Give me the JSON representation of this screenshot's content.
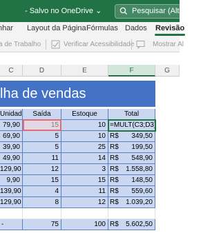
{
  "titlebar": {
    "file_name": "",
    "save_status": "- Salvo no OneDrive ⌄",
    "search_placeholder": "Pesquisar (Alt + G",
    "colors": {
      "accent": "#217346"
    }
  },
  "tabs": [
    "nhar",
    "Layout da Página",
    "Fórmulas",
    "Dados",
    "Revisão",
    "E"
  ],
  "active_tab": "Revisão",
  "ribbon": {
    "item1": "a de Trabalho",
    "item2": "Verificar Acessibilidade",
    "item3": "Mostrar Al"
  },
  "columns": [
    "C",
    "D",
    "E",
    "F",
    "G"
  ],
  "sheet_title": "lha de vendas",
  "table": {
    "headers": [
      "Unidade",
      "Saída",
      "Estoque",
      "Total"
    ],
    "rows": [
      {
        "unidade": "79,90",
        "saida": "15",
        "estoque": "10",
        "total_prefix": "",
        "total": "=MULT(C3;D3)"
      },
      {
        "unidade": "69,90",
        "saida": "5",
        "estoque": "10",
        "total_prefix": "R$",
        "total": "349,50"
      },
      {
        "unidade": "39,90",
        "saida": "5",
        "estoque": "25",
        "total_prefix": "R$",
        "total": "199,50"
      },
      {
        "unidade": "49,90",
        "saida": "11",
        "estoque": "14",
        "total_prefix": "R$",
        "total": "548,90"
      },
      {
        "unidade": "129,90",
        "saida": "12",
        "estoque": "3",
        "total_prefix": "R$",
        "total": "1.558,80"
      },
      {
        "unidade": "9,90",
        "saida": "15",
        "estoque": "15",
        "total_prefix": "R$",
        "total": "148,50"
      },
      {
        "unidade": "139,90",
        "saida": "4",
        "estoque": "11",
        "total_prefix": "R$",
        "total": "559,60"
      },
      {
        "unidade": "129,90",
        "saida": "8",
        "estoque": "12",
        "total_prefix": "R$",
        "total": "1.039,20"
      }
    ],
    "totals": {
      "unidade": "-",
      "saida": "75",
      "estoque": "100",
      "total_prefix": "R$",
      "total": "5.602,50"
    }
  }
}
